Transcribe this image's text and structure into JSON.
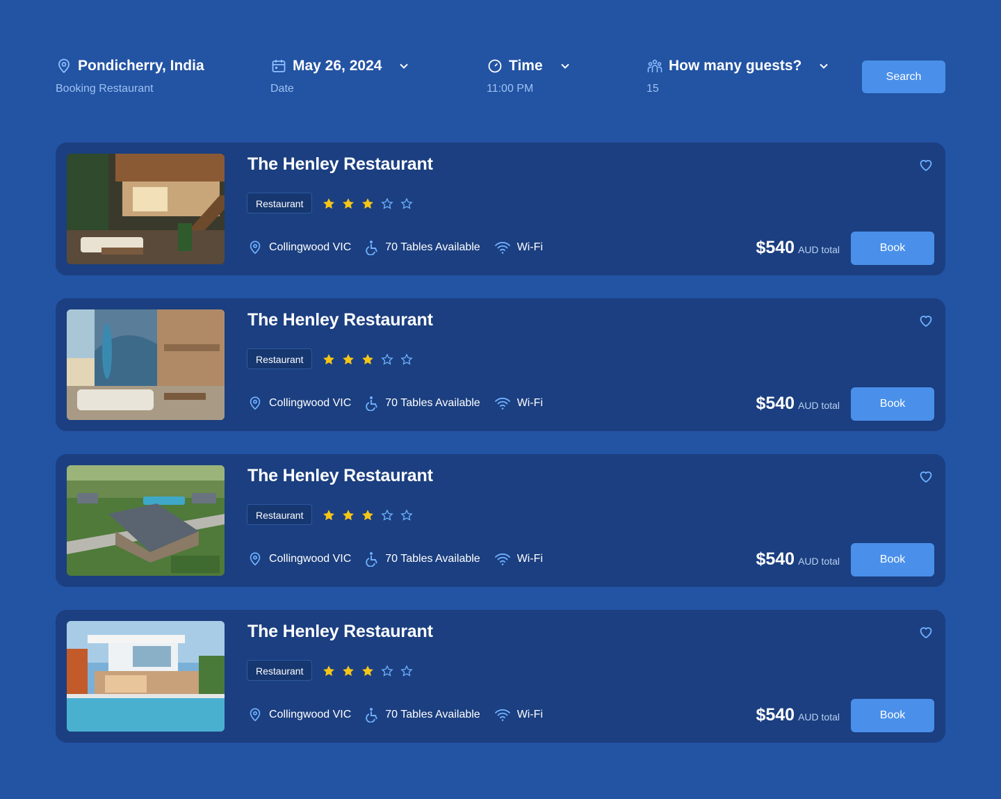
{
  "colors": {
    "background": "#2353a3",
    "card": "#1b3f80",
    "accent": "#4a90ea",
    "star": "#f5c518",
    "muted": "#9dc3f3"
  },
  "filters": {
    "location": {
      "icon": "location-pin-icon",
      "value": "Pondicherry, India",
      "label": "Booking Restaurant"
    },
    "date": {
      "icon": "calendar-icon",
      "value": "May 26, 2024",
      "label": "Date"
    },
    "time": {
      "icon": "clock-icon",
      "value": "Time",
      "label": "11:00 PM"
    },
    "guests": {
      "icon": "users-icon",
      "value": "How many guests?",
      "label": "15"
    },
    "search_label": "Search"
  },
  "listings": [
    {
      "title": "The Henley Restaurant",
      "tag": "Restaurant",
      "rating": 3,
      "rating_max": 5,
      "location": "Collingwood VIC",
      "tables": "70 Tables Available",
      "amenity": "Wi-Fi",
      "price": "$540",
      "price_suffix": "AUD total",
      "book_label": "Book",
      "image": "modern-interior-staircase"
    },
    {
      "title": "The Henley Restaurant",
      "tag": "Restaurant",
      "rating": 3,
      "rating_max": 5,
      "location": "Collingwood VIC",
      "tables": "70 Tables Available",
      "amenity": "Wi-Fi",
      "price": "$540",
      "price_suffix": "AUD total",
      "book_label": "Book",
      "image": "beach-house-living-room"
    },
    {
      "title": "The Henley Restaurant",
      "tag": "Restaurant",
      "rating": 3,
      "rating_max": 5,
      "location": "Collingwood VIC",
      "tables": "70 Tables Available",
      "amenity": "Wi-Fi",
      "price": "$540",
      "price_suffix": "AUD total",
      "book_label": "Book",
      "image": "aerial-neighborhood"
    },
    {
      "title": "The Henley Restaurant",
      "tag": "Restaurant",
      "rating": 3,
      "rating_max": 5,
      "location": "Collingwood VIC",
      "tables": "70 Tables Available",
      "amenity": "Wi-Fi",
      "price": "$540",
      "price_suffix": "AUD total",
      "book_label": "Book",
      "image": "modern-villa-pool"
    }
  ]
}
